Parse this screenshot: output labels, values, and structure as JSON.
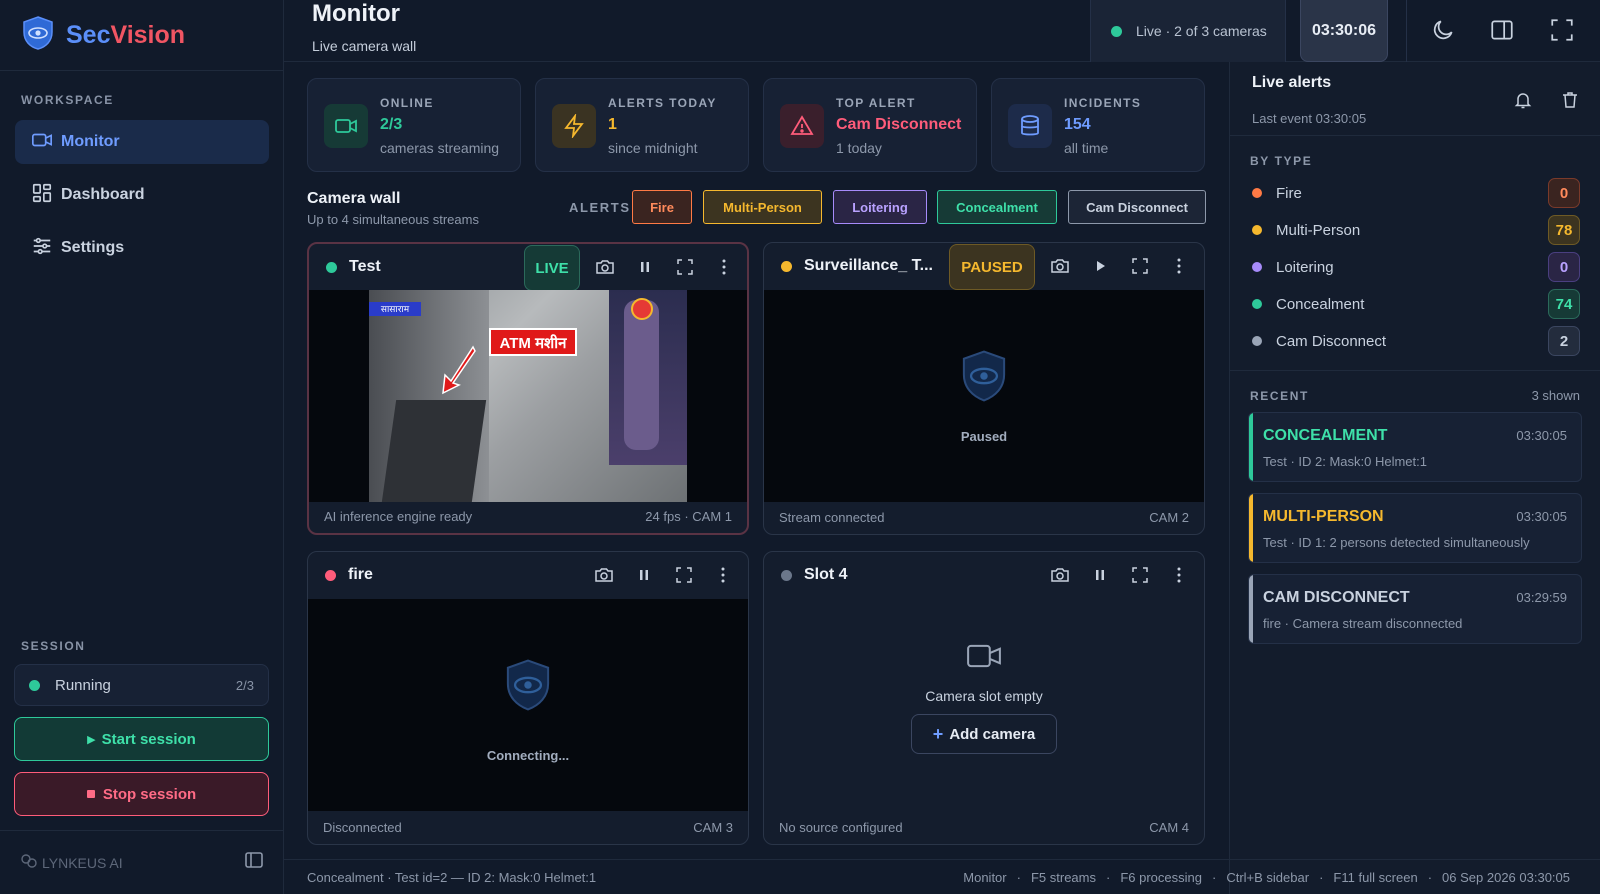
{
  "brand": {
    "name_a": "Sec",
    "name_b": "Vision",
    "colors": {
      "blue": "#5b8ff9",
      "red": "#f05563"
    }
  },
  "sidebar": {
    "workspace_label": "WORKSPACE",
    "items": [
      {
        "label": "Monitor",
        "icon": "video-camera-icon",
        "active": true
      },
      {
        "label": "Dashboard",
        "icon": "grid-icon",
        "active": false
      },
      {
        "label": "Settings",
        "icon": "sliders-icon",
        "active": false
      }
    ],
    "session_label": "SESSION",
    "session": {
      "status": "Running",
      "count": "2/3",
      "status_color": "#2ec99a"
    },
    "start_button": "Start session",
    "stop_button": "Stop session",
    "footer_logo": "LYNKEUS AI"
  },
  "header": {
    "title": "Monitor",
    "subtitle": "Live camera wall",
    "live_status": "Live · 2 of 3 cameras",
    "clock": "03:30:06"
  },
  "stats": [
    {
      "label": "ONLINE",
      "value": "2/3",
      "sub": "cameras streaming",
      "icon": "camera-icon",
      "color": "#2ec99a"
    },
    {
      "label": "ALERTS TODAY",
      "value": "1",
      "sub": "since midnight",
      "icon": "lightning-icon",
      "color": "#f5b82e"
    },
    {
      "label": "TOP ALERT",
      "value": "Cam Disconnect",
      "sub": "1 today",
      "icon": "warning-icon",
      "color": "#ff5c7a"
    },
    {
      "label": "INCIDENTS",
      "value": "154",
      "sub": "all time",
      "icon": "database-icon",
      "color": "#6f9cff"
    }
  ],
  "camera_wall": {
    "title": "Camera wall",
    "subtitle": "Up to 4 simultaneous streams",
    "alerts_label": "ALERTS",
    "alert_chips": [
      "Fire",
      "Multi-Person",
      "Loitering",
      "Concealment",
      "Cam Disconnect"
    ]
  },
  "cameras": [
    {
      "name": "Test",
      "badge": "LIVE",
      "footer_left": "AI inference engine ready",
      "footer_right": "24 fps ·  CAM 1",
      "overlay_label": "ATM मशीन",
      "overlay_tag": "सासाराम"
    },
    {
      "name": "Surveillance_ T...",
      "badge": "PAUSED",
      "center_text": "Paused",
      "footer_left": "Stream connected",
      "footer_right": "CAM 2"
    },
    {
      "name": "fire",
      "center_text": "Connecting...",
      "footer_left": "Disconnected",
      "footer_right": "CAM 3"
    },
    {
      "name": "Slot 4",
      "center_text": "Camera slot empty",
      "add_button": "Add camera",
      "footer_left": "No source configured",
      "footer_right": "CAM 4"
    }
  ],
  "live_alerts": {
    "title": "Live alerts",
    "subtitle": "Last event 03:30:05",
    "by_type_label": "BY TYPE",
    "types": [
      {
        "name": "Fire",
        "count": "0",
        "color": "#ff7a45"
      },
      {
        "name": "Multi-Person",
        "count": "78",
        "color": "#f5b82e"
      },
      {
        "name": "Loitering",
        "count": "0",
        "color": "#a78bfa"
      },
      {
        "name": "Concealment",
        "count": "74",
        "color": "#2ec99a"
      },
      {
        "name": "Cam Disconnect",
        "count": "2",
        "color": "#9aa5b7"
      }
    ],
    "recent_label": "RECENT",
    "recent_count": "3 shown",
    "recent": [
      {
        "title": "CONCEALMENT",
        "time": "03:30:05",
        "desc": "Test · ID 2: Mask:0 Helmet:1",
        "color": "#2ec99a"
      },
      {
        "title": "MULTI-PERSON",
        "time": "03:30:05",
        "desc": "Test · ID 1: 2 persons detected simultaneously",
        "color": "#f5b82e"
      },
      {
        "title": "CAM DISCONNECT",
        "time": "03:29:59",
        "desc": "fire · Camera stream disconnected",
        "color": "#9aa5b7"
      }
    ]
  },
  "statusbar": {
    "left": "Concealment · Test id=2 — ID 2: Mask:0 Helmet:1",
    "items": [
      "Monitor",
      "F5 streams",
      "F6 processing",
      "Ctrl+B sidebar",
      "F11 full screen",
      "06 Sep 2026  03:30:05"
    ]
  }
}
